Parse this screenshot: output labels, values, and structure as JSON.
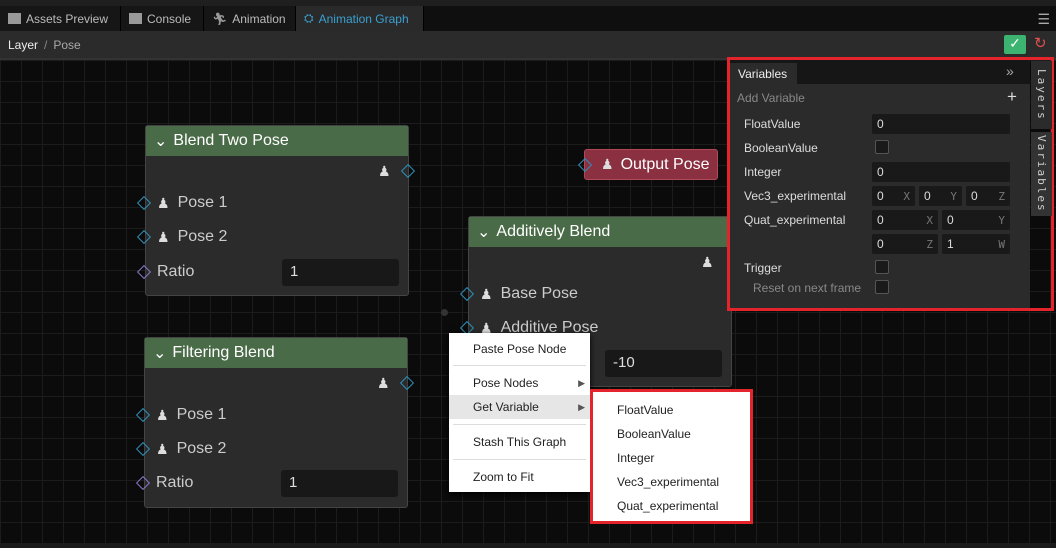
{
  "tabs": [
    {
      "label": "Assets Preview",
      "icon": "folder-icon"
    },
    {
      "label": "Console",
      "icon": "terminal-icon"
    },
    {
      "label": "Animation",
      "icon": "running-icon"
    },
    {
      "label": "Animation Graph",
      "icon": "graph-icon",
      "active": true
    }
  ],
  "breadcrumb": {
    "root": "Layer",
    "sep": "/",
    "current": "Pose"
  },
  "colors": {
    "accent": "#3aa0d0",
    "node_header": "#4a6b47",
    "output_node": "#8b3040",
    "highlight": "#e3242b",
    "confirm": "#3cb371"
  },
  "nodes": {
    "blend_two": {
      "title": "Blend Two Pose",
      "ports": [
        "Pose 1",
        "Pose 2"
      ],
      "ratio_label": "Ratio",
      "ratio": "1"
    },
    "filtering": {
      "title": "Filtering Blend",
      "ports": [
        "Pose 1",
        "Pose 2"
      ],
      "ratio_label": "Ratio",
      "ratio": "1"
    },
    "additive": {
      "title": "Additively Blend",
      "ports": [
        "Base Pose",
        "Additive Pose"
      ],
      "value": "-10"
    },
    "output": {
      "title": "Output Pose"
    }
  },
  "context_menu": {
    "items": [
      "Paste Pose Node",
      "Pose Nodes",
      "Get Variable",
      "Stash This Graph",
      "Zoom to Fit"
    ]
  },
  "submenu": {
    "items": [
      "FloatValue",
      "BooleanValue",
      "Integer",
      "Vec3_experimental",
      "Quat_experimental"
    ]
  },
  "variables": {
    "tab": "Variables",
    "add_label": "Add Variable",
    "float": {
      "label": "FloatValue",
      "value": "0"
    },
    "bool": {
      "label": "BooleanValue",
      "checked": false
    },
    "int": {
      "label": "Integer",
      "value": "0"
    },
    "vec3": {
      "label": "Vec3_experimental",
      "x": "0",
      "y": "0",
      "z": "0"
    },
    "quat": {
      "label": "Quat_experimental",
      "x": "0",
      "y": "0",
      "z": "0",
      "w": "1"
    },
    "trigger": {
      "label": "Trigger",
      "checked": false
    },
    "reset": {
      "label": "Reset on next frame",
      "checked": false
    },
    "axes": {
      "x": "X",
      "y": "Y",
      "z": "Z",
      "w": "W"
    }
  },
  "side_tabs": [
    "Layers",
    "Variables"
  ]
}
